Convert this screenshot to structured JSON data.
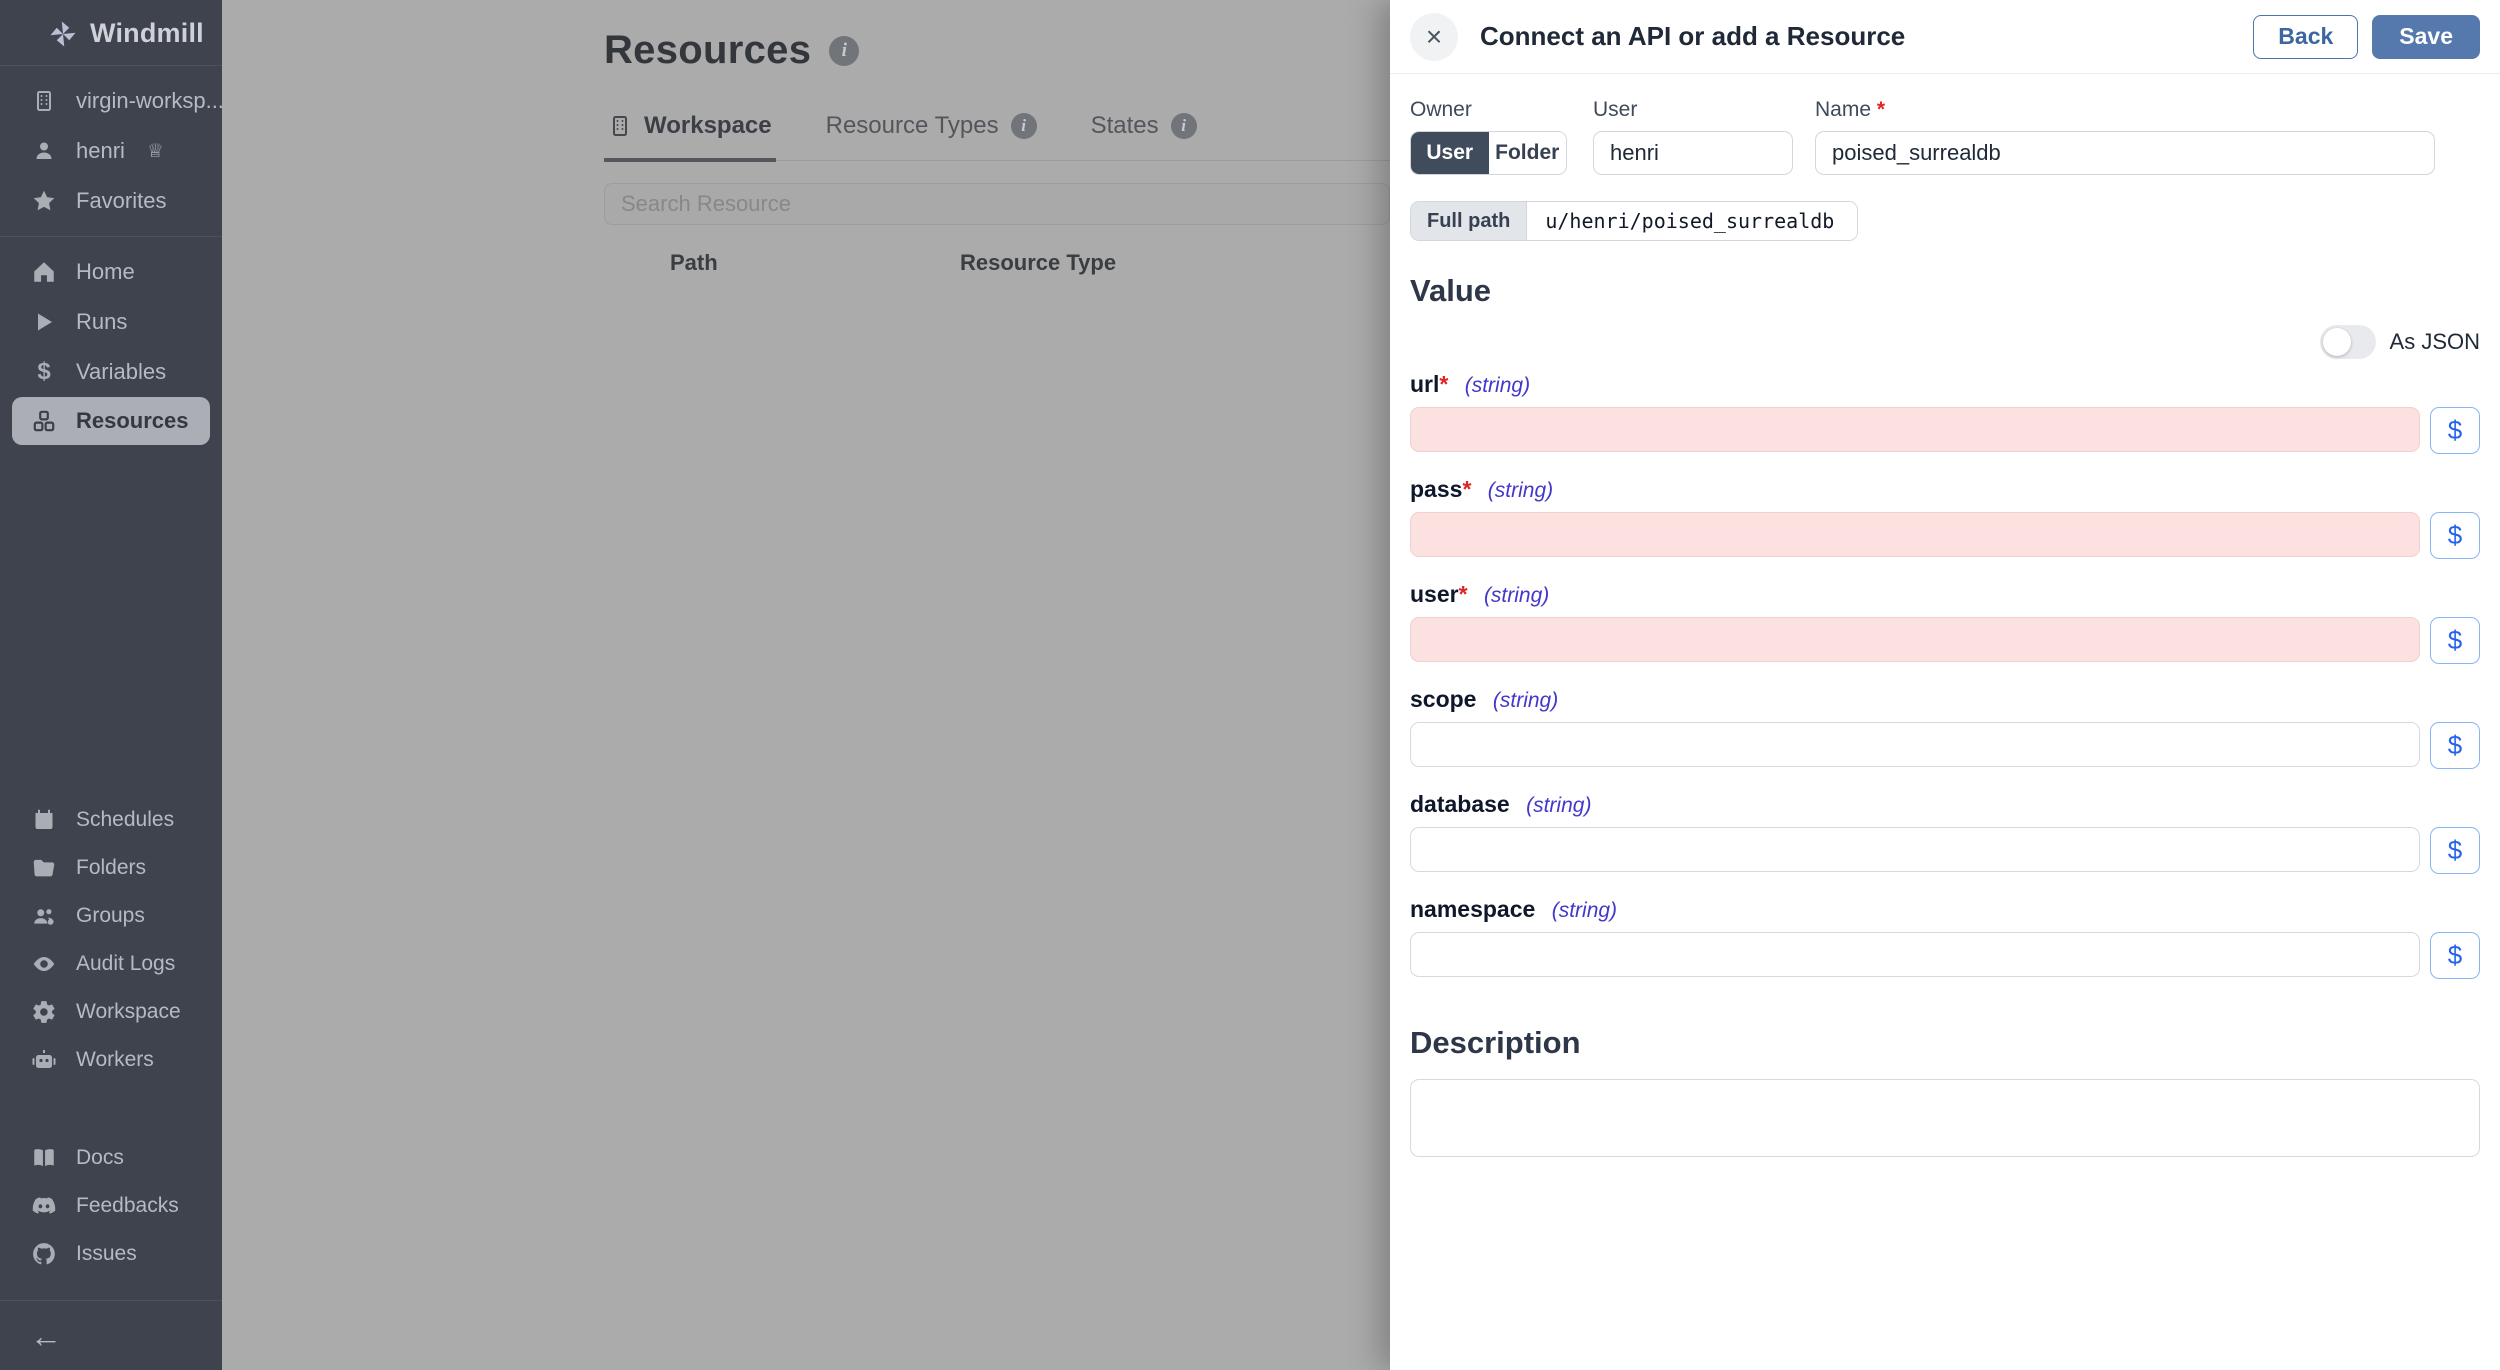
{
  "icons": {
    "close": "×",
    "crown": "♕",
    "info": "i",
    "dollar": "$",
    "arrow_left": "←"
  },
  "colors": {
    "sidebar_bg": "#3e434d",
    "overlay_dim": "#ababab",
    "accent_save": "#5578ad",
    "invalid_field_bg": "#fce1e1",
    "required_red": "#dc2626",
    "type_indigo": "#4338ca",
    "expr_blue": "#2563eb",
    "selected_segment": "#404b5c"
  },
  "sidebar": {
    "logo": "Windmill",
    "workspace": "virgin-worksp...",
    "user": "henri",
    "favorites": "Favorites",
    "nav": [
      {
        "label": "Home"
      },
      {
        "label": "Runs"
      },
      {
        "label": "Variables"
      },
      {
        "label": "Resources",
        "active": true
      }
    ],
    "admin": [
      {
        "label": "Schedules"
      },
      {
        "label": "Folders"
      },
      {
        "label": "Groups"
      },
      {
        "label": "Audit Logs"
      },
      {
        "label": "Workspace"
      },
      {
        "label": "Workers"
      }
    ],
    "help": [
      {
        "label": "Docs"
      },
      {
        "label": "Feedbacks"
      },
      {
        "label": "Issues"
      }
    ]
  },
  "main": {
    "title": "Resources",
    "tabs": [
      {
        "label": "Workspace",
        "active": true
      },
      {
        "label": "Resource Types",
        "has_info": true
      },
      {
        "label": "States",
        "has_info": true
      }
    ],
    "search_placeholder": "Search Resource",
    "table": {
      "columns": [
        "Path",
        "Resource Type"
      ]
    }
  },
  "drawer": {
    "title": "Connect an API or add a Resource",
    "back_label": "Back",
    "save_label": "Save",
    "required_marker": "*",
    "owner": {
      "label": "Owner",
      "options": [
        "User",
        "Folder"
      ],
      "selected": "User"
    },
    "user_field": {
      "label": "User",
      "value": "henri"
    },
    "name_field": {
      "label": "Name",
      "required": true,
      "value": "poised_surrealdb"
    },
    "full_path": {
      "label": "Full path",
      "value": "u/henri/poised_surrealdb"
    },
    "value_section": {
      "heading": "Value",
      "as_json_label": "As JSON",
      "as_json_on": false,
      "expr_button_label": "$",
      "fields": [
        {
          "name": "url",
          "type": "(string)",
          "required": true,
          "invalid": true,
          "value": ""
        },
        {
          "name": "pass",
          "type": "(string)",
          "required": true,
          "invalid": true,
          "value": ""
        },
        {
          "name": "user",
          "type": "(string)",
          "required": true,
          "invalid": true,
          "value": ""
        },
        {
          "name": "scope",
          "type": "(string)",
          "required": false,
          "invalid": false,
          "value": ""
        },
        {
          "name": "database",
          "type": "(string)",
          "required": false,
          "invalid": false,
          "value": ""
        },
        {
          "name": "namespace",
          "type": "(string)",
          "required": false,
          "invalid": false,
          "value": ""
        }
      ]
    },
    "description": {
      "heading": "Description",
      "value": ""
    }
  }
}
